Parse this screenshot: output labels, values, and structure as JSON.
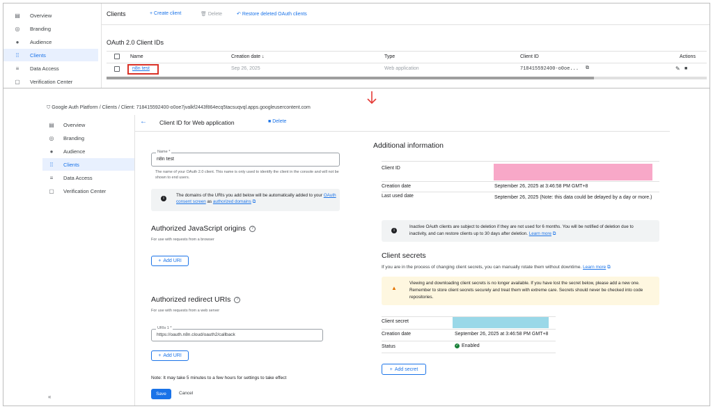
{
  "top": {
    "sidebar": [
      {
        "icon": "overview-icon",
        "glyph": "▤",
        "label": "Overview"
      },
      {
        "icon": "branding-icon",
        "glyph": "◎",
        "label": "Branding"
      },
      {
        "icon": "audience-icon",
        "glyph": "●",
        "label": "Audience"
      },
      {
        "icon": "clients-icon",
        "glyph": "⁞⁞",
        "label": "Clients"
      },
      {
        "icon": "data-access-icon",
        "glyph": "≡",
        "label": "Data Access"
      },
      {
        "icon": "verification-icon",
        "glyph": "▢",
        "label": "Verification Center"
      }
    ],
    "active_index": 3,
    "header": {
      "title": "Clients",
      "create": "Create client",
      "delete": "Delete",
      "restore": "Restore deleted OAuth clients"
    },
    "section_title": "OAuth 2.0 Client IDs",
    "table": {
      "headers": {
        "name": "Name",
        "date": "Creation date",
        "type": "Type",
        "client_id": "Client ID",
        "actions": "Actions"
      },
      "row": {
        "name": "n8n test",
        "date": "Sep 26, 2025",
        "type": "Web application",
        "client_id": "718415592400-o0oe..."
      }
    }
  },
  "arrow_color": "#e53935",
  "breadcrumb": {
    "root": "Google Auth Platform",
    "clients": "Clients",
    "current": "Client: 718415592400-o0oe7jvalkf2443f864ecq5tacsuqvql.apps.googleusercontent.com"
  },
  "bottom": {
    "sidebar": [
      {
        "icon": "overview-icon",
        "glyph": "▤",
        "label": "Overview"
      },
      {
        "icon": "branding-icon",
        "glyph": "◎",
        "label": "Branding"
      },
      {
        "icon": "audience-icon",
        "glyph": "●",
        "label": "Audience"
      },
      {
        "icon": "clients-icon",
        "glyph": "⁞⁞",
        "label": "Clients"
      },
      {
        "icon": "data-access-icon",
        "glyph": "≡",
        "label": "Data Access"
      },
      {
        "icon": "verification-icon",
        "glyph": "▢",
        "label": "Verification Center"
      }
    ],
    "active_index": 3,
    "collapse": "«",
    "page_title": "Client ID for Web application",
    "delete": "Delete",
    "name_field": {
      "label": "Name *",
      "value": "n8n test",
      "help": "The name of your OAuth 2.0 client. This name is only used to identify the client in the console and will not be shown to end users."
    },
    "info_box": {
      "text_a": "The domains of the URIs you add below will be automatically added to your ",
      "link1": "OAuth consent screen",
      "text_b": " as ",
      "link2": "authorized domains"
    },
    "js_origins": {
      "title": "Authorized JavaScript origins",
      "sub": "For use with requests from a browser",
      "add": "Add URI"
    },
    "redirects": {
      "title": "Authorized redirect URIs",
      "sub": "For use with requests from a web server",
      "field_label": "URIs 1 *",
      "value": "https://oauth.n8n.cloud/oauth2/callback",
      "add": "Add URI"
    },
    "note": "Note: It may take 5 minutes to a few hours for settings to take effect",
    "save": "Save",
    "cancel": "Cancel",
    "additional": {
      "title": "Additional information",
      "client_id_label": "Client ID",
      "creation_label": "Creation date",
      "creation_value": "September 26, 2025 at 3:46:58 PM GMT+8",
      "last_used_label": "Last used date",
      "last_used_value": "September 26, 2025 (Note: this data could be delayed by a day or more.)",
      "inactive_note": "Inactive OAuth clients are subject to deletion if they are not used for 6 months. You will be notified of deletion due to inactivity, and can restore clients up to 30 days after deletion.",
      "learn_more": "Learn more"
    },
    "secrets": {
      "title": "Client secrets",
      "sub": "If you are in the process of changing client secrets, you can manually rotate them without downtime.",
      "learn_more": "Learn more",
      "warning": "Viewing and downloading client secrets is no longer available. If you have lost the secret below, please add a new one. Remember to store client secrets securely and treat them with extreme care. Secrets should never be checked into code repositories.",
      "secret_label": "Client secret",
      "creation_label": "Creation date",
      "creation_value": "September 26, 2025 at 3:46:58 PM GMT+8",
      "status_label": "Status",
      "status_value": "Enabled",
      "add": "Add secret"
    }
  },
  "colors": {
    "accent": "#1a73e8",
    "redact_pink": "#f8a8c8",
    "redact_blue": "#9ad8e8",
    "warning_bg": "#fef7e0",
    "info_bg": "#f1f3f4",
    "highlight": "#d93025",
    "enabled": "#188038"
  }
}
